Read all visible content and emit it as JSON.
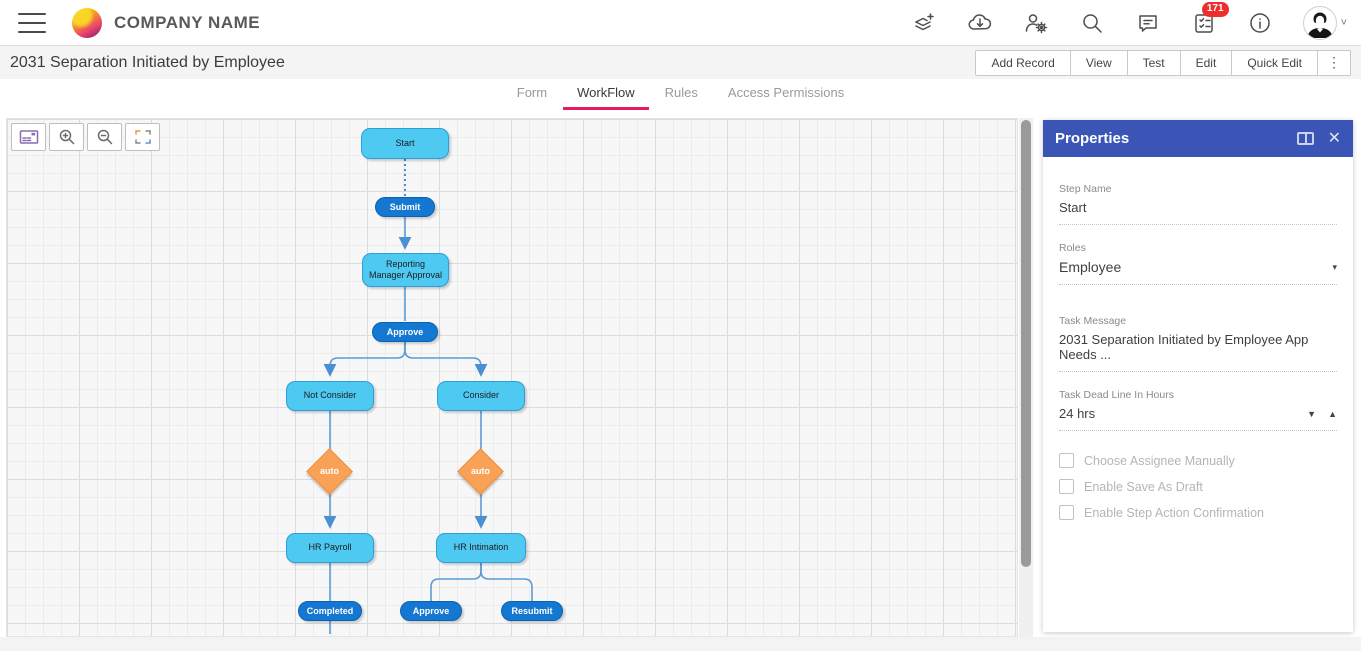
{
  "topbar": {
    "company_name": "COMPANY NAME",
    "notification_count": "171",
    "icons": [
      "layers-add-icon",
      "cloud-download-icon",
      "user-settings-icon",
      "search-icon",
      "chat-icon",
      "tasks-icon",
      "info-icon",
      "avatar",
      "chevron-down-icon"
    ]
  },
  "record_header": {
    "title": "2031 Separation Initiated by Employee",
    "actions": [
      "Add Record",
      "View",
      "Test",
      "Edit",
      "Quick Edit"
    ]
  },
  "tabs": [
    {
      "label": "Form",
      "active": false
    },
    {
      "label": "WorkFlow",
      "active": true
    },
    {
      "label": "Rules",
      "active": false
    },
    {
      "label": "Access Permissions",
      "active": false
    }
  ],
  "canvas_toolbar": [
    "overview-icon",
    "zoom-in-icon",
    "zoom-out-icon",
    "fullscreen-icon"
  ],
  "workflow": {
    "nodes": {
      "start": {
        "label": "Start",
        "type": "step"
      },
      "submit": {
        "label": "Submit",
        "type": "action"
      },
      "reporting_manager_approval": {
        "label": "Reporting Manager Approval",
        "type": "step"
      },
      "approve1": {
        "label": "Approve",
        "type": "action"
      },
      "not_consider": {
        "label": "Not Consider",
        "type": "step"
      },
      "consider": {
        "label": "Consider",
        "type": "step"
      },
      "auto_left": {
        "label": "auto",
        "type": "condition"
      },
      "auto_right": {
        "label": "auto",
        "type": "condition"
      },
      "hr_payroll": {
        "label": "HR Payroll",
        "type": "step"
      },
      "hr_intimation": {
        "label": "HR Intimation",
        "type": "step"
      },
      "completed": {
        "label": "Completed",
        "type": "action"
      },
      "approve2": {
        "label": "Approve",
        "type": "action"
      },
      "resubmit": {
        "label": "Resubmit",
        "type": "action"
      }
    }
  },
  "properties": {
    "title": "Properties",
    "fields": {
      "step_name": {
        "label": "Step Name",
        "value": "Start"
      },
      "roles": {
        "label": "Roles",
        "value": "Employee"
      },
      "task_message": {
        "label": "Task Message",
        "value": "2031 Separation Initiated by Employee App Needs ..."
      },
      "deadline": {
        "label": "Task Dead Line In Hours",
        "value": "24 hrs"
      }
    },
    "checkboxes": [
      {
        "label": "Choose Assignee Manually",
        "checked": false
      },
      {
        "label": "Enable Save As Draft",
        "checked": false
      },
      {
        "label": "Enable Step Action Confirmation",
        "checked": false
      }
    ]
  },
  "glyphs": {
    "kebab": "⋮",
    "caret_down": "▼",
    "caret_up": "▲",
    "dropdown_caret": "▾",
    "close": "✕",
    "chevron_down": "˅"
  },
  "colors": {
    "accent_blue": "#3a55b5",
    "node_cyan": "#4dc9f2",
    "oval_blue": "#1478d2",
    "diamond_orange": "#f9a156",
    "edge_blue": "#5b9bd5",
    "tab_underline": "#ea1b5c",
    "badge_red": "#ee2d2d"
  }
}
